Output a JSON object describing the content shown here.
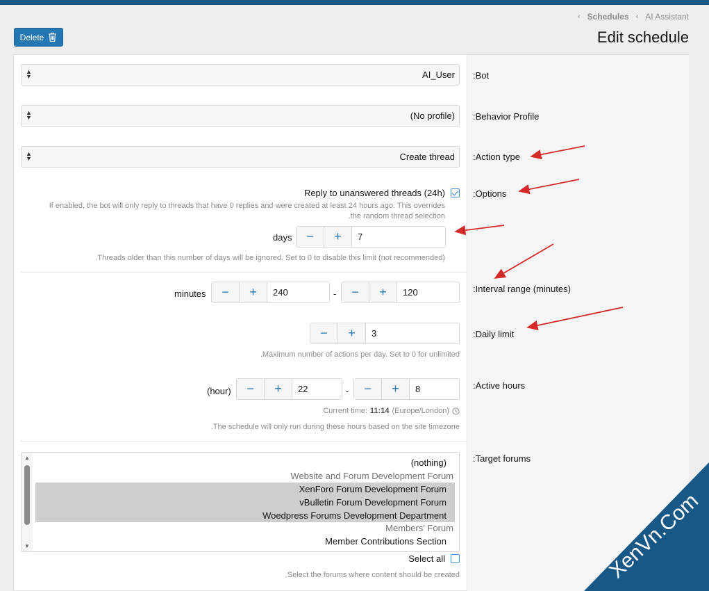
{
  "breadcrumb": {
    "items": [
      "Schedules",
      "AI Assistant"
    ]
  },
  "page": {
    "title": "Edit schedule",
    "delete_label": "Delete"
  },
  "fields": {
    "bot": {
      "label": ":Bot",
      "value": "AI_User"
    },
    "behavior": {
      "label": ":Behavior Profile",
      "value": "(No profile)"
    },
    "action": {
      "label": ":Action type",
      "value": "Create thread"
    },
    "options": {
      "label": ":Options",
      "reply_label": "Reply to unanswered threads (24h)",
      "reply_checked": true,
      "reply_hint_1": "If enabled, the bot will only reply to threads that have 0 replies and were created at least 24 hours ago. This overrides",
      "reply_hint_2": ".the random thread selection",
      "days_unit": "days",
      "days_value": "7",
      "days_hint": ".Threads older than this number of days will be ignored. Set to 0 to disable this limit (not recommended)"
    },
    "interval": {
      "label": ":Interval range (minutes)",
      "unit": "minutes",
      "min": "240",
      "max": "120",
      "sep": "-"
    },
    "daily": {
      "label": ":Daily limit",
      "value": "3",
      "hint": ".Maximum number of actions per day. Set to 0 for unlimited"
    },
    "active": {
      "label": ":Active hours",
      "unit": "(hour)",
      "start": "22",
      "end": "8",
      "sep": "-",
      "time_prefix": "Current time:",
      "time_value": "11:14",
      "time_zone": "(Europe/London)",
      "hint": ".The schedule will only run during these hours based on the site timezone"
    },
    "forums": {
      "label": ":Target forums",
      "options": [
        {
          "text": "(nothing)",
          "kind": "child"
        },
        {
          "text": "Website and Forum Development Forum",
          "kind": "group"
        },
        {
          "text": "XenForo Forum Development Forum",
          "kind": "selected"
        },
        {
          "text": "vBulletin Forum Development Forum",
          "kind": "selected"
        },
        {
          "text": "Woedpress Forums Development Department",
          "kind": "selected"
        },
        {
          "text": "Members' Forum",
          "kind": "group"
        },
        {
          "text": "Member Contributions Section",
          "kind": "child"
        }
      ],
      "select_all_label": "Select all",
      "select_all_checked": false,
      "hint": ".Select the forums where content should be created"
    }
  },
  "watermark": {
    "text": "XenVn.Com",
    "color": "#185886"
  },
  "colors": {
    "primary": "#2577b1",
    "topbar": "#185886",
    "arrow": "#d42a2a"
  }
}
